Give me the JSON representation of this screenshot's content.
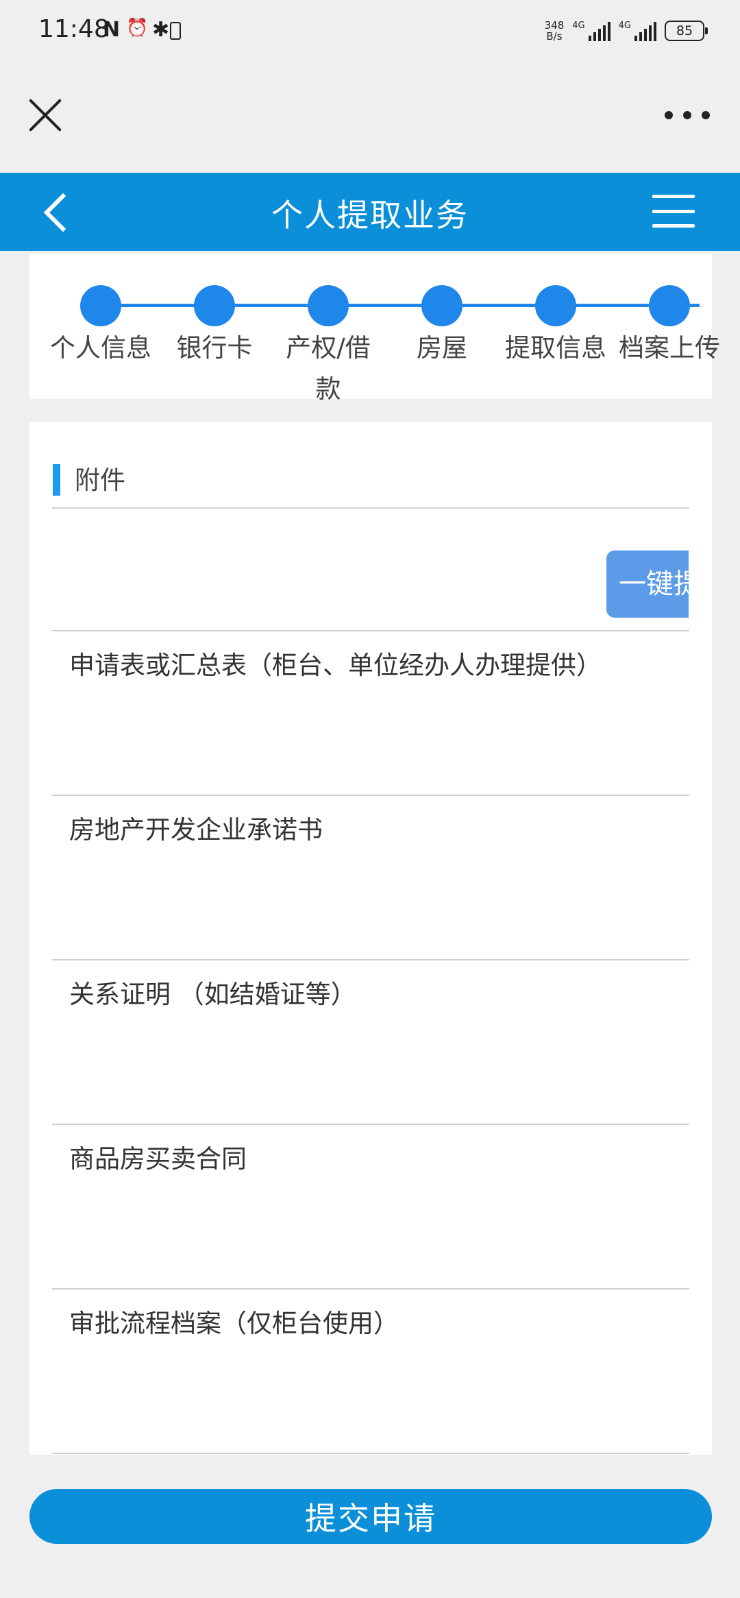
{
  "status_bar": {
    "time": "11:48",
    "nfc_icon": "N",
    "alarm_icon": "⏰",
    "bluetooth_icon": "✱",
    "net_speed_value": "348",
    "net_speed_unit": "B/s",
    "signal_1_label": "4G",
    "signal_2_label": "4G",
    "battery": "85"
  },
  "header": {
    "title": "个人提取业务"
  },
  "steps": [
    {
      "label": "个人信息"
    },
    {
      "label": "银行卡"
    },
    {
      "label": "产权/借\n款"
    },
    {
      "label": "房屋"
    },
    {
      "label": "提取信息"
    },
    {
      "label": "档案上传"
    }
  ],
  "attachments": {
    "title": "附件",
    "one_click_button": "一键提交",
    "documents": [
      {
        "label": "申请表或汇总表（柜台、单位经办人办理提供）"
      },
      {
        "label": "房地产开发企业承诺书"
      },
      {
        "label": "关系证明 （如结婚证等）"
      },
      {
        "label": "商品房买卖合同"
      },
      {
        "label": "审批流程档案（仅柜台使用）"
      }
    ]
  },
  "submit_button": "提交申请",
  "colors": {
    "primary": "#0b8fd8",
    "step": "#1f87ea",
    "one_click": "#5b9be8",
    "background": "#efeff0"
  }
}
